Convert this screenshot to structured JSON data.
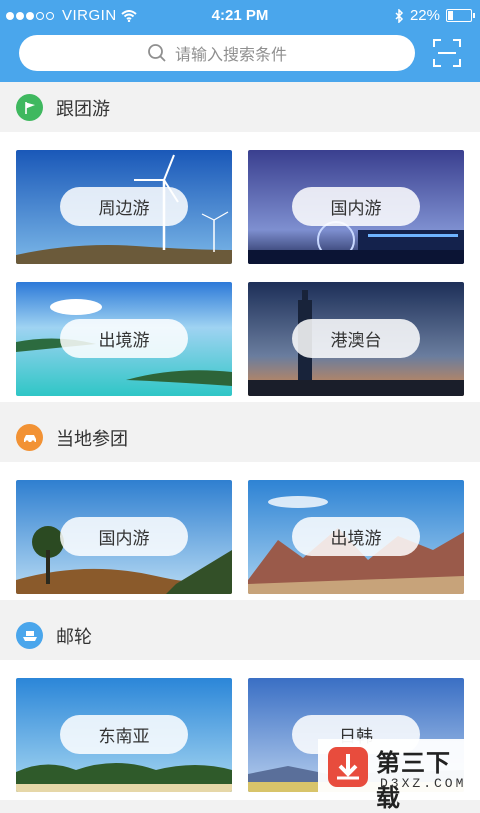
{
  "status": {
    "carrier": "VIRGIN",
    "time": "4:21 PM",
    "battery": "22%",
    "battery_level": 0.22
  },
  "search": {
    "placeholder": "请输入搜索条件"
  },
  "sections": [
    {
      "title": "跟团游",
      "icon": "flag-icon",
      "color": "#3fb85f",
      "tiles": [
        "周边游",
        "国内游",
        "出境游",
        "港澳台"
      ]
    },
    {
      "title": "当地参团",
      "icon": "car-icon",
      "color": "#f29234",
      "tiles": [
        "国内游",
        "出境游"
      ]
    },
    {
      "title": "邮轮",
      "icon": "ship-icon",
      "color": "#4aa6ec",
      "tiles": [
        "东南亚",
        "日韩"
      ]
    }
  ],
  "watermark": {
    "name": "第三下载",
    "domain": "D3XZ.COM"
  }
}
